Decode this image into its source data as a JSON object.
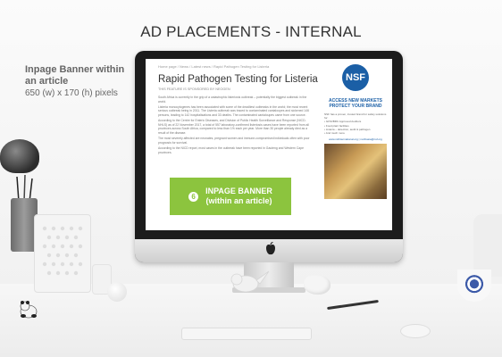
{
  "page": {
    "headline": "AD PLACEMENTS - INTERNAL",
    "placement_title": "Inpage Banner within an article",
    "placement_dims": "650 (w) x 170 (h) pixels"
  },
  "screen": {
    "breadcrumb": "Home page  /  News  /  Latest news  /  Rapid Pathogen Testing for Listeria",
    "article_title": "Rapid Pathogen Testing for Listeria",
    "sponsor_line": "THIS FEATURE IS SPONSORED BY NEOGEN",
    "body": [
      "South Africa is currently in the grip of a catastrophic listeriosis outbreak – potentially the biggest outbreak in the world.",
      "Listeria monocytogenes has been associated with some of the deadliest outbreaks in the world; the most recent serious outbreak being in 2011. The Listeria outbreak was traced to contaminated cantaloupes and sickened 146 persons, leading to 142 hospitalisations and 33 deaths. The contaminated cantaloupes came from one source.",
      "According to the Centre for Enteric Diseases, and Division of Public Health Surveillance and Response (NICD-NHLS) as of 22 November 2017, a total of 557 laboratory-confirmed listeriosis cases have been reported from all provinces across South Africa, compared to less than 1% each per year. More than 30 people already died as a result of the disease.",
      "The most severely affected are neonates, pregnant women and immune-compromised individuals often with poor prognosis for survival.",
      "According to the NICD report, most cases in the outbreak have been reported in Gauteng and Western Cape provinces."
    ],
    "banner": {
      "badge": "6",
      "line1": "INPAGE BANNER",
      "line2": "(within an article)"
    },
    "ad": {
      "logo": "NSF",
      "heading": "ACCESS NEW MARKETS PROTECT YOUR BRAND",
      "lines": [
        "NSF has a proven, trusted brand for safety solutions for:",
        "• GFSI/BRC Approved Auditors",
        "• Food plant facilities",
        "• Listeria – detection, audit & pathogen",
        "• And much more"
      ],
      "links": "www.nsfinternational.org  |  northasia@nsf.org"
    }
  },
  "colors": {
    "banner_green": "#8cc43e",
    "nsf_blue": "#1b5fa6",
    "monitor_bezel": "#1c1c1c"
  }
}
